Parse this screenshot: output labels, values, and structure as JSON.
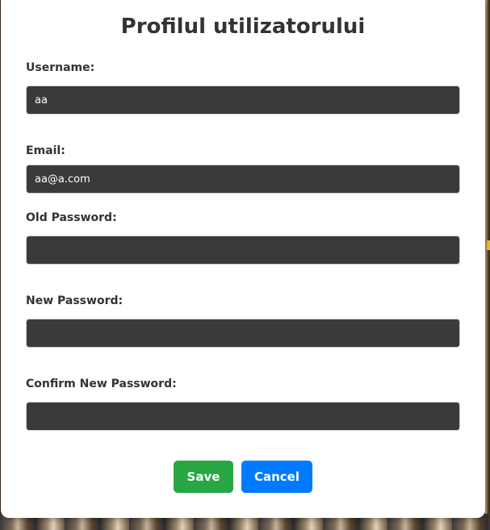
{
  "title": "Profilul utilizatorului",
  "fields": {
    "username": {
      "label": "Username:",
      "value": "aa",
      "placeholder": ""
    },
    "email": {
      "label": "Email:",
      "value": "aa@a.com",
      "placeholder": ""
    },
    "old_password": {
      "label": "Old Password:",
      "value": "",
      "placeholder": ""
    },
    "new_password": {
      "label": "New Password:",
      "value": "",
      "placeholder": ""
    },
    "confirm_password": {
      "label": "Confirm New Password:",
      "value": "",
      "placeholder": ""
    }
  },
  "buttons": {
    "save": {
      "label": "Save",
      "color": "#28a745"
    },
    "cancel": {
      "label": "Cancel",
      "color": "#007bff"
    }
  },
  "colors": {
    "input_background": "#3a3a3a",
    "text": "#333333"
  }
}
